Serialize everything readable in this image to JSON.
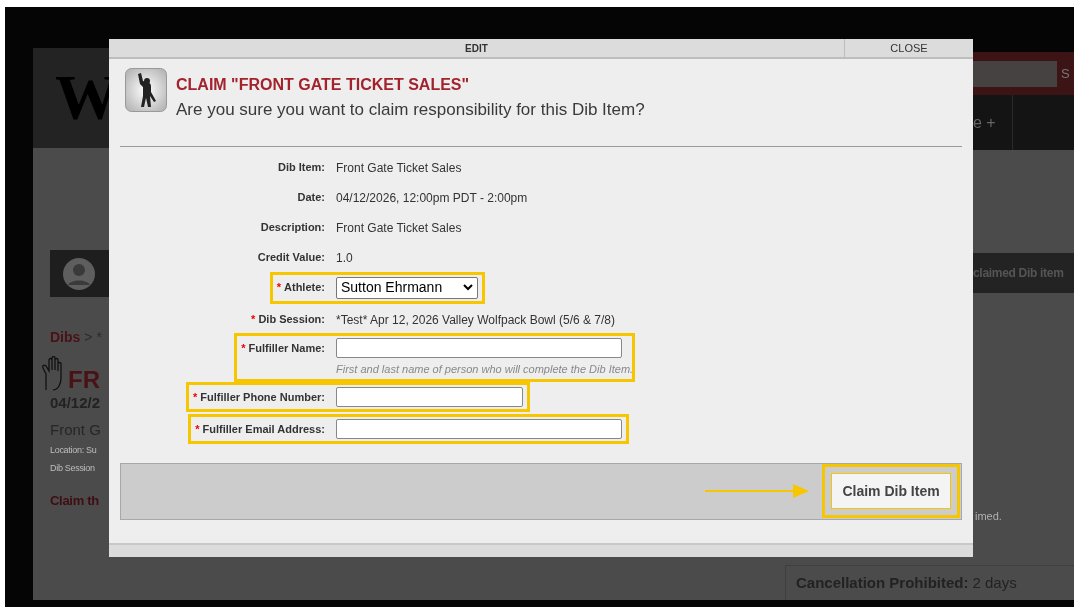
{
  "background_page": {
    "logo_text": "W",
    "search_button": "S",
    "nav_item": "e +",
    "notice": "claimed Dib item",
    "breadcrumb": {
      "link": "Dibs",
      "rest": "> *"
    },
    "heading": "FR",
    "date": "04/12/2",
    "item_title": "Front G",
    "location": "Location: Su",
    "session": "Dib Session",
    "claim_link": "Claim th",
    "note": "imed.",
    "cancellation": {
      "label": "Cancellation Prohibited:",
      "value": "2 days"
    }
  },
  "dialog": {
    "header_title": "EDIT",
    "close": "CLOSE",
    "title": "CLAIM \"FRONT GATE TICKET SALES\"",
    "subtitle": "Are you sure you want to claim responsibility for this Dib Item?",
    "fields": [
      {
        "kind": "text",
        "label": "Dib Item:",
        "highlighted": false,
        "value": "Front Gate Ticket Sales"
      },
      {
        "kind": "text",
        "label": "Date:",
        "highlighted": false,
        "value": "04/12/2026, 12:00pm PDT - 2:00pm"
      },
      {
        "kind": "text",
        "label": "Description:",
        "highlighted": false,
        "value": "Front Gate Ticket Sales"
      },
      {
        "kind": "text",
        "label": "Credit Value:",
        "highlighted": false,
        "value": "1.0"
      },
      {
        "kind": "select",
        "label": "Athlete:",
        "required_mark": "*",
        "highlighted": true,
        "value": "Sutton Ehrmann"
      },
      {
        "kind": "text",
        "label": "Dib Session:",
        "required_mark": "*",
        "highlighted": false,
        "value": "*Test* Apr 12, 2026 Valley Wolfpack Bowl (5/6 & 7/8)"
      },
      {
        "kind": "name",
        "label": "Fulfiller Name:",
        "required_mark": "*",
        "highlighted": true,
        "help": "First and last name of person who will complete the Dib Item."
      },
      {
        "kind": "phone",
        "label": "Fulfiller Phone Number:",
        "required_mark": "*",
        "highlighted": true
      },
      {
        "kind": "email",
        "label": "Fulfiller Email Address:",
        "required_mark": "*",
        "highlighted": true
      }
    ],
    "submit": {
      "label": "Claim Dib Item",
      "highlighted": true
    }
  }
}
